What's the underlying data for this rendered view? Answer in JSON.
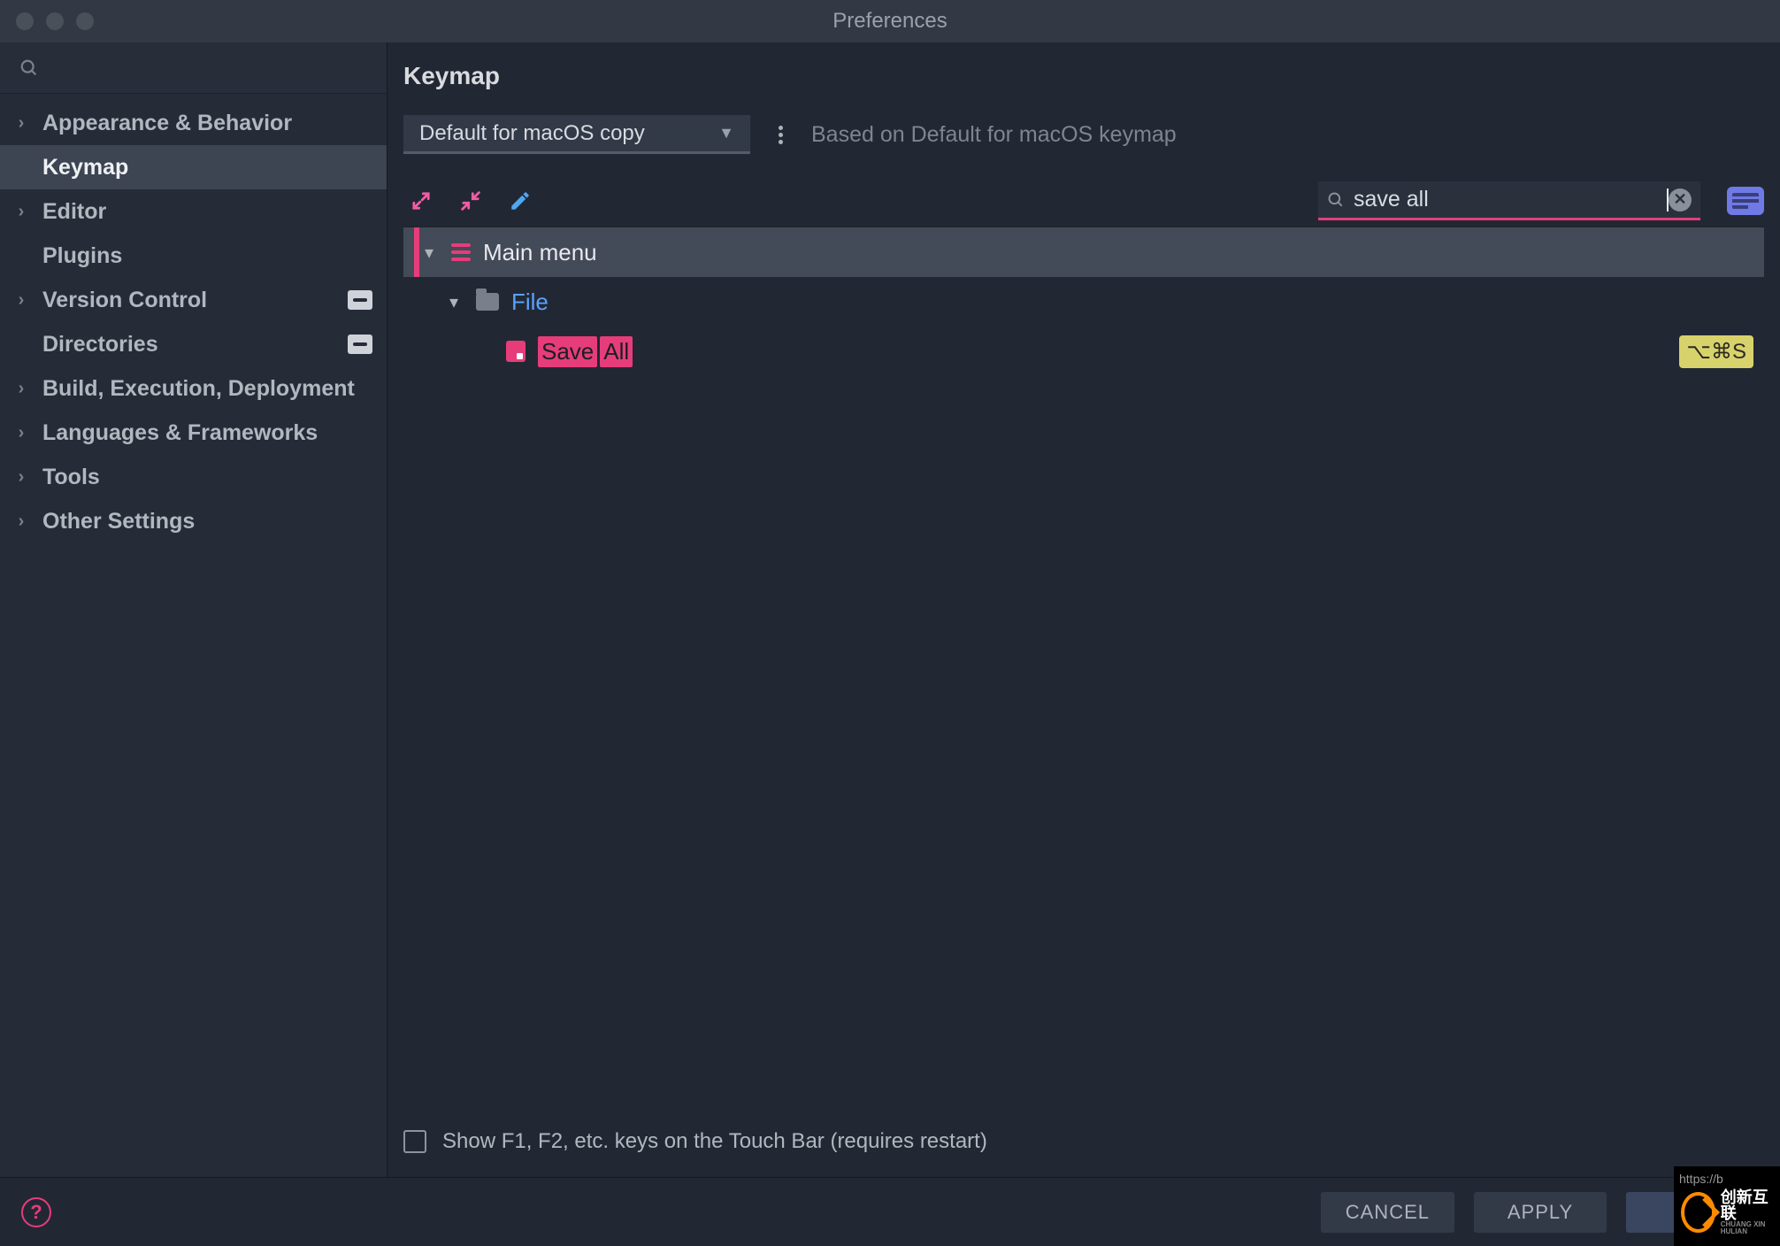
{
  "window": {
    "title": "Preferences"
  },
  "sidebar": {
    "search_placeholder": "",
    "items": [
      {
        "label": "Appearance & Behavior",
        "expandable": true
      },
      {
        "label": "Keymap",
        "expandable": false,
        "selected": true
      },
      {
        "label": "Editor",
        "expandable": true
      },
      {
        "label": "Plugins",
        "expandable": false
      },
      {
        "label": "Version Control",
        "expandable": true,
        "badge": "profile"
      },
      {
        "label": "Directories",
        "expandable": false,
        "badge": "profile"
      },
      {
        "label": "Build, Execution, Deployment",
        "expandable": true
      },
      {
        "label": "Languages & Frameworks",
        "expandable": true
      },
      {
        "label": "Tools",
        "expandable": true
      },
      {
        "label": "Other Settings",
        "expandable": true
      }
    ]
  },
  "main": {
    "heading": "Keymap",
    "scheme_selected": "Default for macOS copy",
    "scheme_description": "Based on Default for macOS keymap",
    "search_value": "save all",
    "tree": {
      "root": {
        "label": "Main menu"
      },
      "file": {
        "label": "File"
      },
      "action": {
        "word1": "Save",
        "word2": "All",
        "shortcut": "⌥⌘S"
      }
    },
    "touchbar_checkbox_label": "Show F1, F2, etc. keys on the Touch Bar (requires restart)"
  },
  "footer": {
    "cancel": "CANCEL",
    "apply": "APPLY",
    "ok": ""
  },
  "watermark": {
    "url_fragment": "https://b",
    "brand": "创新互联",
    "brand_sub": "CHUANG XIN HULIAN"
  }
}
